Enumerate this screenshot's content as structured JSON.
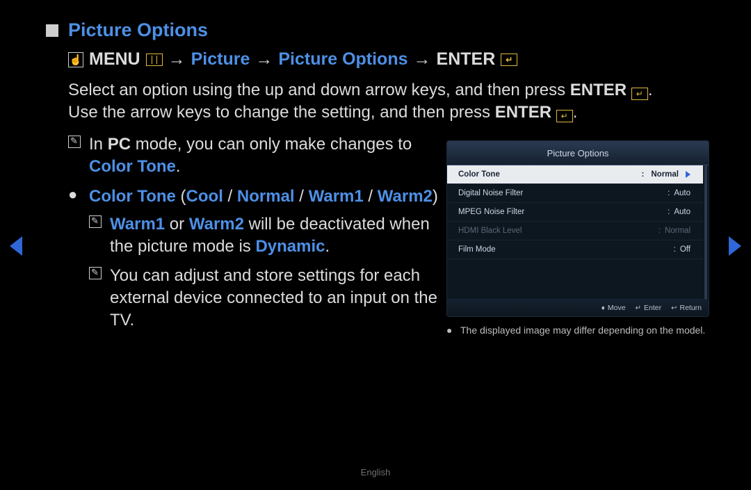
{
  "title": "Picture Options",
  "path": {
    "menu": "MENU",
    "seg1": "Picture",
    "seg2": "Picture Options",
    "enter": "ENTER"
  },
  "intro": {
    "line1_a": "Select an option using the up and down arrow keys, and then press ",
    "line1_b": "ENTER",
    "line1_c": ".",
    "line2_a": "Use the arrow keys to change the setting, and then press ",
    "line2_b": "ENTER",
    "line2_c": "."
  },
  "notes": {
    "pc_a": "In ",
    "pc_b": "PC",
    "pc_c": " mode, you can only make changes to ",
    "pc_d": "Color Tone",
    "pc_e": ".",
    "option_label": "Color Tone",
    "option_paren_open": " (",
    "option_v1": "Cool",
    "option_sep": " / ",
    "option_v2": "Normal",
    "option_v3": "Warm1",
    "option_v4": "Warm2",
    "option_paren_close": ")",
    "warm_a": "Warm1",
    "warm_b": " or ",
    "warm_c": "Warm2",
    "warm_d": " will be deactivated when the picture mode is ",
    "warm_e": "Dynamic",
    "warm_f": ".",
    "store": "You can adjust and store settings for each external device connected to an input on the TV."
  },
  "osd": {
    "title": "Picture Options",
    "rows": [
      {
        "label": "Color Tone",
        "value": "Normal",
        "state": "selected"
      },
      {
        "label": "Digital Noise Filter",
        "value": "Auto",
        "state": "normal"
      },
      {
        "label": "MPEG Noise Filter",
        "value": "Auto",
        "state": "normal"
      },
      {
        "label": "HDMI Black Level",
        "value": "Normal",
        "state": "disabled"
      },
      {
        "label": "Film Mode",
        "value": "Off",
        "state": "normal"
      }
    ],
    "footer": {
      "move": "Move",
      "enter": "Enter",
      "return": "Return"
    }
  },
  "caption": "The displayed image may differ depending on the model.",
  "footer_lang": "English"
}
